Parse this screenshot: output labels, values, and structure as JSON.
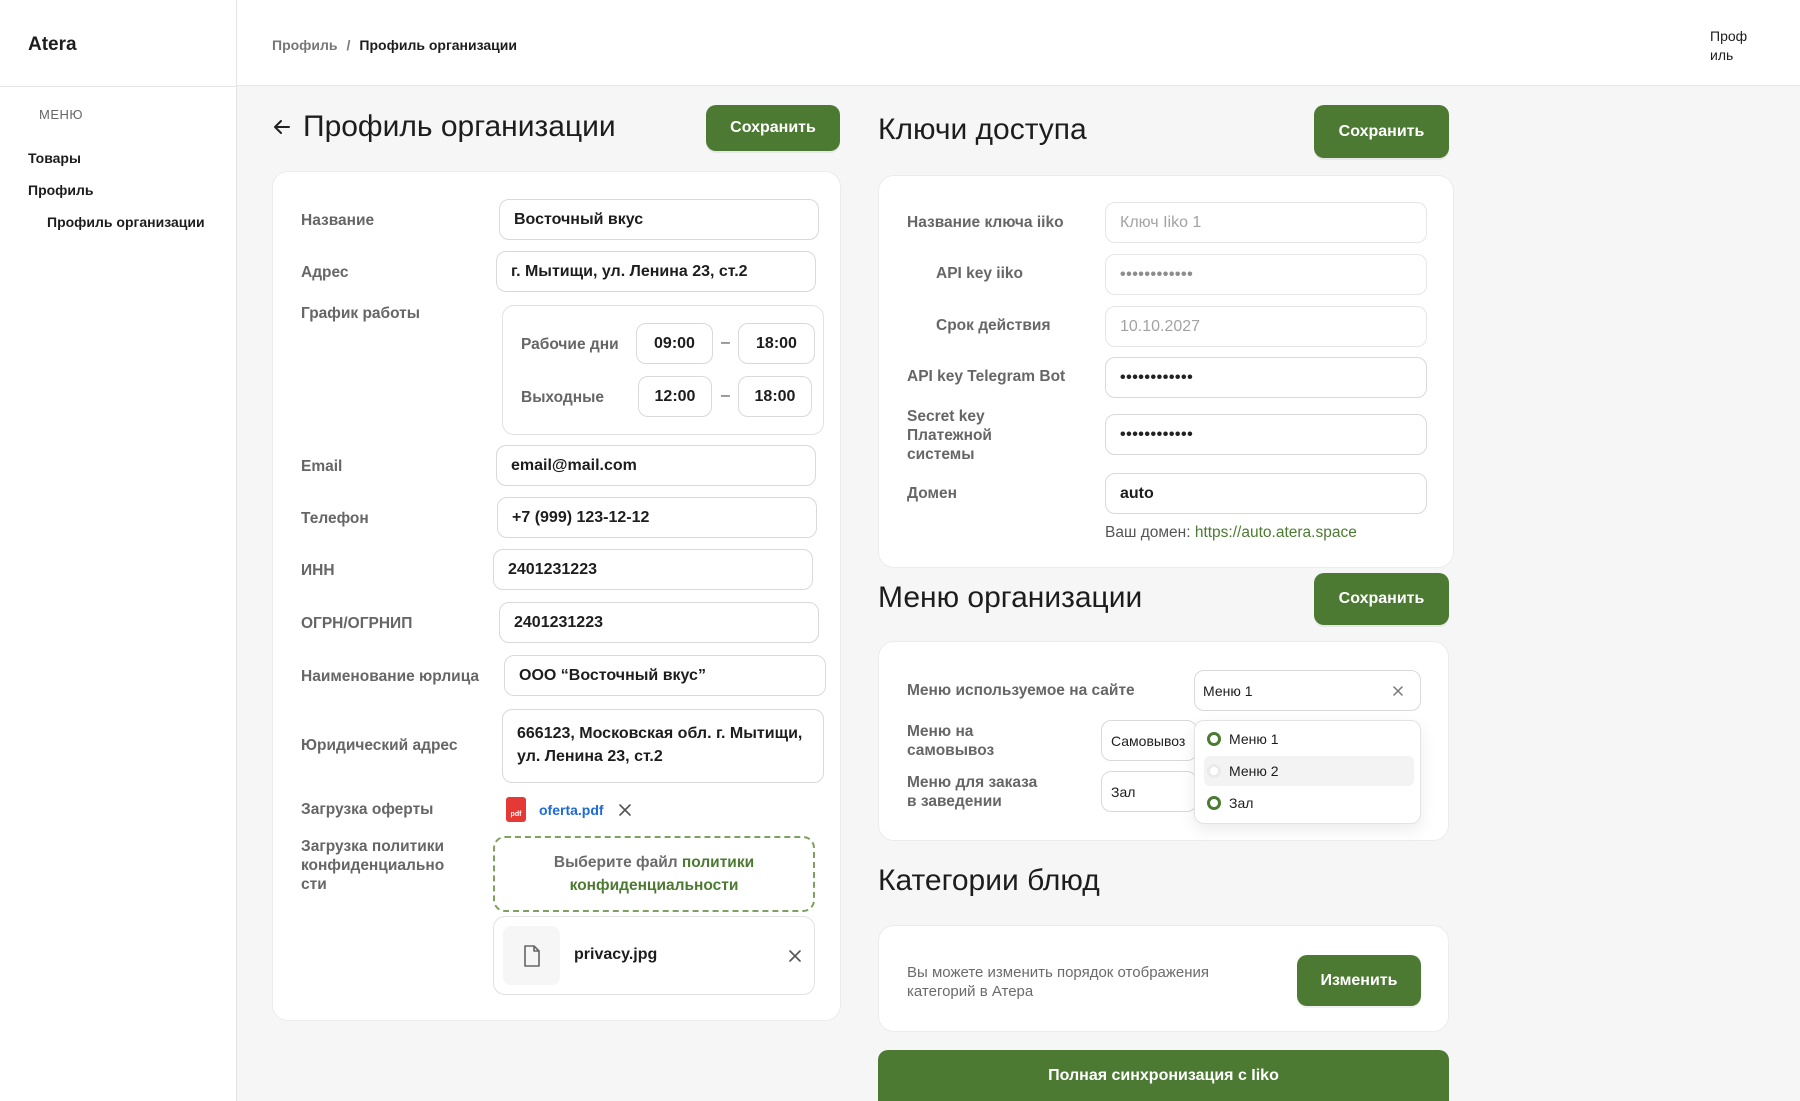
{
  "app": {
    "brand": "Atera"
  },
  "sidebar": {
    "menu_title": "МЕНЮ",
    "items": [
      {
        "label": "Товары"
      },
      {
        "label": "Профиль"
      },
      {
        "label": "Профиль организации"
      }
    ]
  },
  "header": {
    "breadcrumb": {
      "parent": "Профиль",
      "separator": "/",
      "current": "Профиль организации"
    },
    "profile_label": "Проф иль"
  },
  "org": {
    "title": "Профиль организации",
    "save_label": "Сохранить",
    "name": {
      "label": "Название",
      "value": "Восточный вкус"
    },
    "address": {
      "label": "Адрес",
      "value": "г. Мытищи, ул. Ленина 23, ст.2"
    },
    "schedule": {
      "label": "График работы",
      "workdays": {
        "label": "Рабочие дни",
        "from": "09:00",
        "to": "18:00"
      },
      "weekends": {
        "label": "Выходные",
        "from": "12:00",
        "to": "18:00"
      },
      "dash": "–"
    },
    "email": {
      "label": "Email",
      "value": "email@mail.com"
    },
    "phone": {
      "label": "Телефон",
      "value": "+7 (999) 123-12-12"
    },
    "inn": {
      "label": "ИНН",
      "value": "2401231223"
    },
    "ogrn": {
      "label": "ОГРН/ОГРНИП",
      "value": "2401231223"
    },
    "legal_name": {
      "label": "Наименование юрлица",
      "value": "ООО “Восточный вкус”"
    },
    "legal_address": {
      "label": "Юридический адрес",
      "line1": "666123, Московская обл. г. Мытищи,",
      "line2": "ул. Ленина 23, ст.2"
    },
    "offer": {
      "label": "Загрузка оферты",
      "file": "oferta.pdf",
      "icon_text": "pdf"
    },
    "privacy": {
      "label_1": "Загрузка политики",
      "label_2": "конфиденциально",
      "label_3": "сти",
      "drop_prefix": "Выберите файл ",
      "drop_link_1": "политики",
      "drop_link_2": "конфиденциальности",
      "file": "privacy.jpg"
    }
  },
  "keys": {
    "title": "Ключи доступа",
    "save_label": "Сохранить",
    "iiko_name": {
      "label": "Название ключа iiko",
      "placeholder": "Ключ Iiko 1"
    },
    "iiko_api": {
      "label": "API key iiko",
      "value": "••••••••••••"
    },
    "validity": {
      "label": "Срок действия",
      "placeholder": "10.10.2027"
    },
    "telegram": {
      "label": "API key Telegram Bot",
      "value": "••••••••••••"
    },
    "payment": {
      "label_1": "Secret key",
      "label_2": "Платежной",
      "label_3": "системы",
      "value": "••••••••••••"
    },
    "domain": {
      "label": "Домен",
      "value": "auto",
      "hint_prefix": "Ваш домен: ",
      "hint_link": "https://auto.atera.space"
    }
  },
  "menu": {
    "title": "Меню организации",
    "save_label": "Сохранить",
    "site": {
      "label": "Меню используемое на сайте",
      "value": "Меню 1"
    },
    "pickup": {
      "label_1": "Меню на",
      "label_2": "самовывоз",
      "value": "Самовывоз"
    },
    "hall": {
      "label_1": "Меню для заказа",
      "label_2": "в заведении",
      "value": "Зал"
    },
    "options": [
      {
        "label": "Меню 1",
        "selected": true
      },
      {
        "label": "Меню 2",
        "selected": false
      },
      {
        "label": "Зал",
        "selected": true
      }
    ]
  },
  "categories": {
    "title": "Категории блюд",
    "text_1": "Вы можете изменить порядок отображения",
    "text_2": "категорий в Атера",
    "button": "Изменить"
  },
  "sync": {
    "label": "Полная синхронизация с Iiko"
  },
  "colors": {
    "accent": "#4d7a32",
    "link_blue": "#1d6bd6",
    "pdf_red": "#e53935"
  }
}
